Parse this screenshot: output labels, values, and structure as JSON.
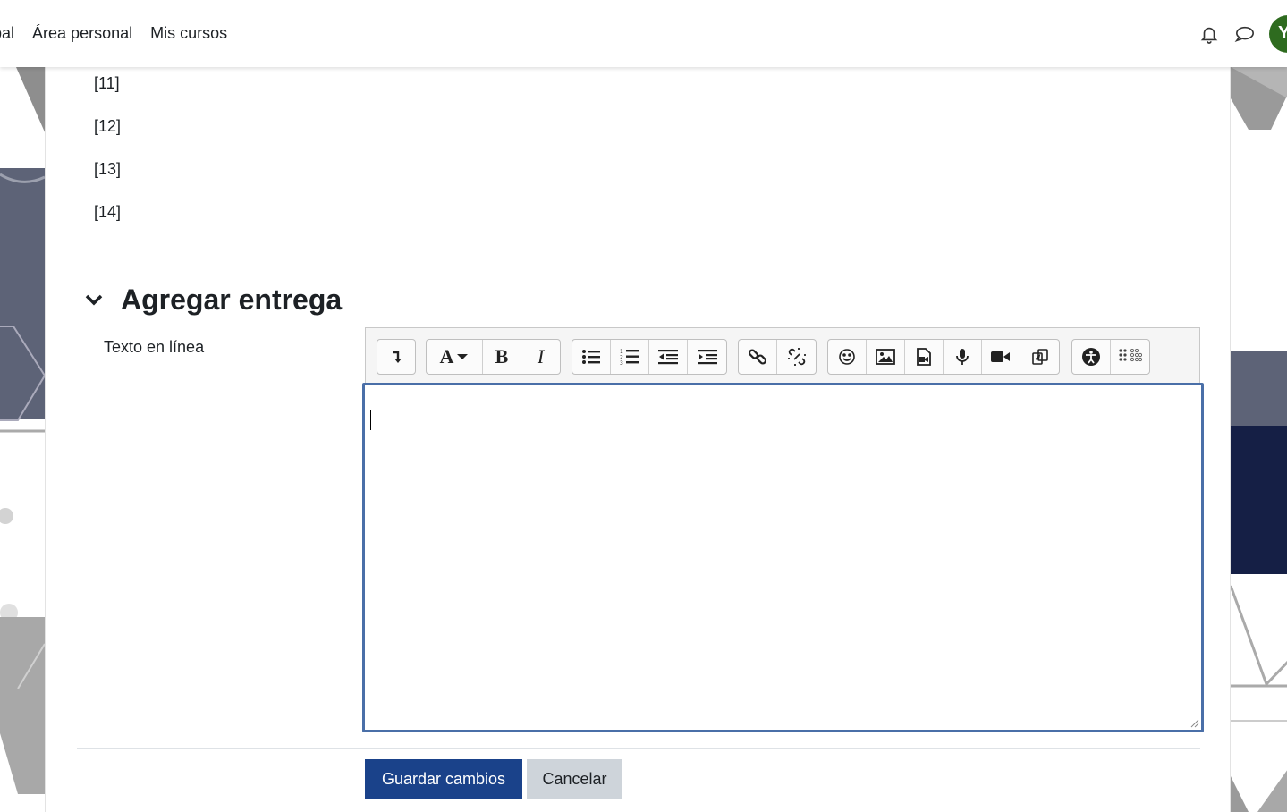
{
  "navbar": {
    "links": [
      "pal",
      "Área personal",
      "Mis cursos"
    ],
    "avatar_initial": "Y",
    "icons": [
      "bell-icon",
      "chat-bubble-icon"
    ],
    "avatar_color": "#2e6b1f"
  },
  "content": {
    "list_items": [
      "[11]",
      "[12]",
      "[13]",
      "[14]"
    ],
    "section_title": "Agregar entrega",
    "field_label": "Texto en línea",
    "editor_value": ""
  },
  "toolbar": {
    "groups": [
      [
        "expand-toolbar-icon"
      ],
      [
        "font-style-icon",
        "bold-icon",
        "italic-icon"
      ],
      [
        "unordered-list-icon",
        "ordered-list-icon",
        "outdent-icon",
        "indent-icon"
      ],
      [
        "link-icon",
        "unlink-icon"
      ],
      [
        "emoji-icon",
        "image-icon",
        "media-icon",
        "record-audio-icon",
        "record-video-icon",
        "manage-files-icon"
      ],
      [
        "accessibility-checker-icon",
        "screenreader-helper-icon"
      ]
    ]
  },
  "actions": {
    "save_label": "Guardar cambios",
    "cancel_label": "Cancelar"
  },
  "colors": {
    "primary": "#1a428a",
    "secondary": "#ced4da",
    "editor_border": "#4a6fa8"
  }
}
